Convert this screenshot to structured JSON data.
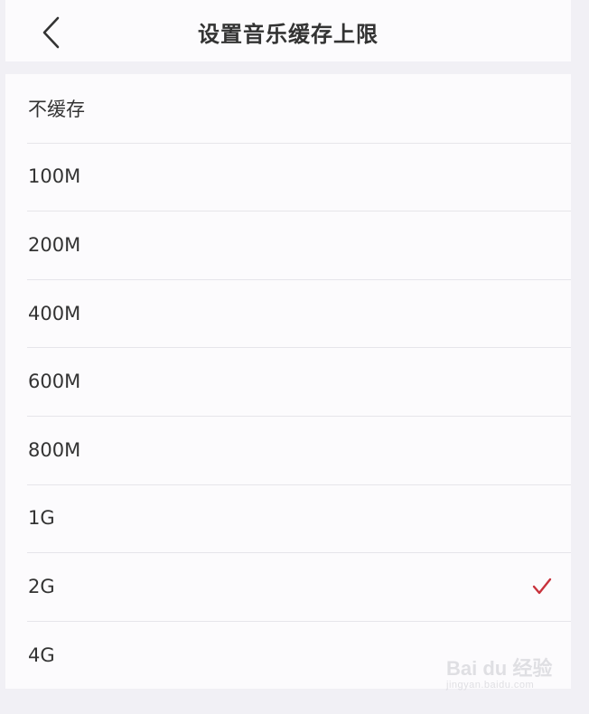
{
  "header": {
    "title": "设置音乐缓存上限",
    "back_icon": "chevron-left-icon"
  },
  "options": [
    {
      "label": "不缓存",
      "selected": false
    },
    {
      "label": "100M",
      "selected": false
    },
    {
      "label": "200M",
      "selected": false
    },
    {
      "label": "400M",
      "selected": false
    },
    {
      "label": "600M",
      "selected": false
    },
    {
      "label": "800M",
      "selected": false
    },
    {
      "label": "1G",
      "selected": false
    },
    {
      "label": "2G",
      "selected": true
    },
    {
      "label": "4G",
      "selected": false
    }
  ],
  "selected_icon": "checkmark-icon",
  "colors": {
    "background": "#f1f0f5",
    "surface": "#fcfbfd",
    "text": "#333333",
    "divider": "#e6e5ea",
    "accent": "#c8323c"
  },
  "watermark": {
    "logo": "Bai du 经验",
    "url": "jingyan.baidu.com"
  }
}
